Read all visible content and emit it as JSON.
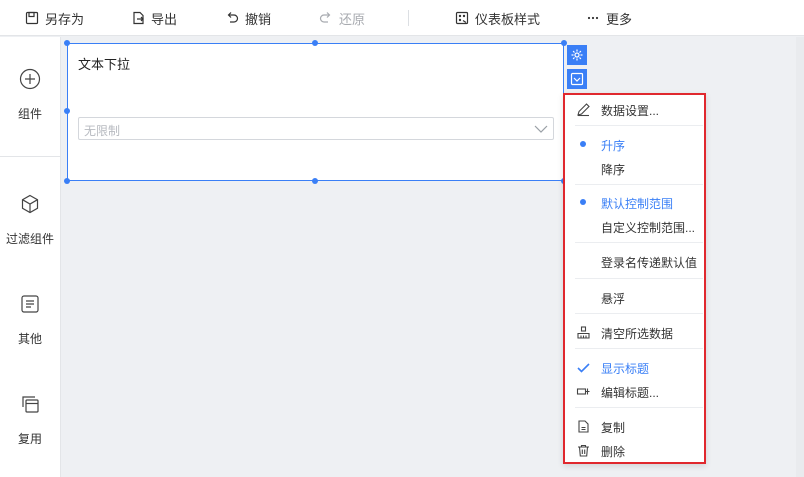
{
  "toolbar": {
    "save_as": "另存为",
    "export": "导出",
    "undo": "撤销",
    "redo": "还原",
    "dashboard_style": "仪表板样式",
    "more": "更多"
  },
  "sidebar": {
    "items": [
      {
        "label": "组件",
        "icon": "plus-circle-icon"
      },
      {
        "label": "过滤组件",
        "icon": "cube-icon"
      },
      {
        "label": "其他",
        "icon": "list-box-icon"
      },
      {
        "label": "复用",
        "icon": "stacked-windows-icon"
      }
    ]
  },
  "widget": {
    "title": "文本下拉",
    "placeholder": "无限制"
  },
  "menu": {
    "items": [
      {
        "label": "数据设置...",
        "icon": "pencil-icon"
      },
      {
        "label": "升序",
        "icon": "dot-icon",
        "active": true
      },
      {
        "label": "降序"
      },
      {
        "label": "默认控制范围",
        "icon": "dot-icon",
        "active": true
      },
      {
        "label": "自定义控制范围..."
      },
      {
        "label": "登录名传递默认值"
      },
      {
        "label": "悬浮"
      },
      {
        "label": "清空所选数据",
        "icon": "broom-icon"
      },
      {
        "label": "显示标题",
        "icon": "check-icon",
        "active": true
      },
      {
        "label": "编辑标题...",
        "icon": "edit-title-icon"
      },
      {
        "label": "复制",
        "icon": "copy-icon"
      },
      {
        "label": "删除",
        "icon": "trash-icon"
      }
    ]
  },
  "colors": {
    "accent": "#3a7ff6",
    "highlight_border": "#e0282e"
  }
}
